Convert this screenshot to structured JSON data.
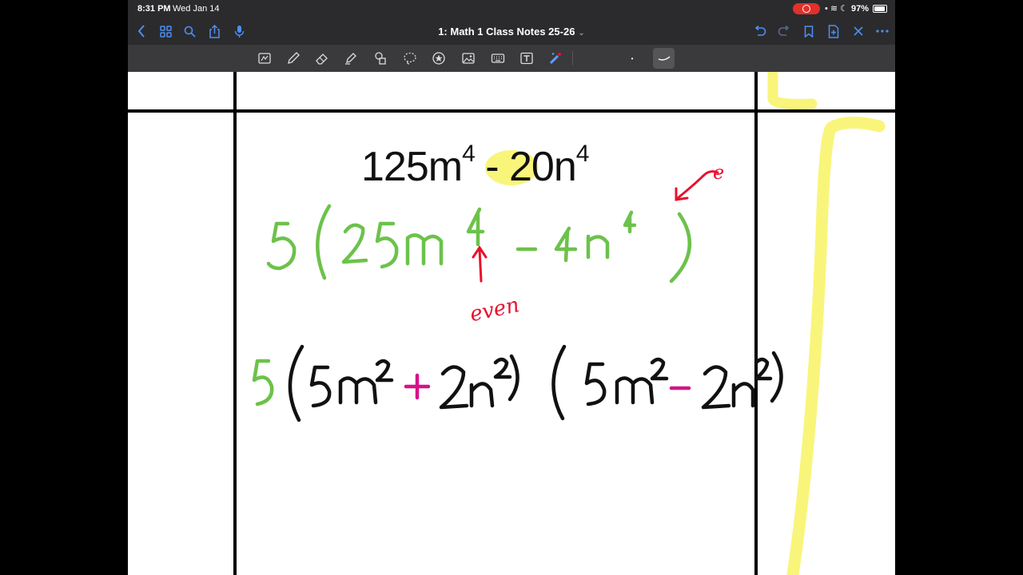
{
  "status_bar": {
    "time": "8:31 PM",
    "date": "Wed Jan 14",
    "battery_percent": "97%"
  },
  "nav_bar": {
    "title": "1: Math 1 Class Notes 25-26",
    "icons": [
      "back-icon",
      "grid-icon",
      "search-icon",
      "share-icon",
      "microphone-icon",
      "undo-icon",
      "redo-icon",
      "bookmark-icon",
      "add-page-icon",
      "close-icon",
      "more-icon"
    ]
  },
  "toolbar": {
    "tools": [
      "read-only-icon",
      "pen-icon",
      "eraser-icon",
      "highlighter-icon",
      "shapes-icon",
      "lasso-icon",
      "elements-icon",
      "image-icon",
      "keyboard-icon",
      "text-box-icon",
      "laser-pointer-icon"
    ],
    "stroke_size_label": "•"
  },
  "note": {
    "typed_expression": {
      "coefficient": "125m",
      "exp1": "4",
      "operator": "-",
      "term2": "20n",
      "exp2": "4"
    },
    "annotation_even": "even",
    "annotation_e": "e",
    "colors": {
      "ink_green": "#6cc24a",
      "ink_black": "#111111",
      "ink_red": "#e8112d",
      "ink_magenta": "#d6128a",
      "highlight_yellow": "#f9f57a"
    }
  }
}
